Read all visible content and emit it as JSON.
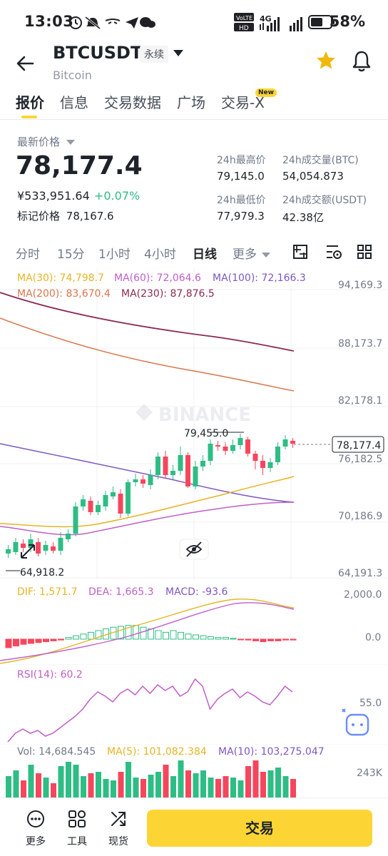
{
  "status_bar": {
    "time": "13:03",
    "network": "4G",
    "battery_pct": "58%"
  },
  "header": {
    "symbol": "BTCUSDT",
    "tag": "永续",
    "subtitle": "Bitcoin"
  },
  "tabs": [
    {
      "label": "报价",
      "active": true
    },
    {
      "label": "信息",
      "active": false
    },
    {
      "label": "交易数据",
      "active": false
    },
    {
      "label": "广场",
      "active": false
    },
    {
      "label": "交易-X",
      "active": false
    }
  ],
  "tab_badge": "New",
  "price_panel": {
    "latest_label": "最新价格",
    "last_price": "78,177.4",
    "fiat_price": "¥533,951.64",
    "change_pct": "+0.07%",
    "mark_label": "标记价格",
    "mark_price": "78,167.6",
    "stats": {
      "high_label": "24h最高价",
      "high": "79,145.0",
      "vol_btc_label": "24h成交量(BTC)",
      "vol_btc": "54,054.873",
      "low_label": "24h最低价",
      "low": "77,979.3",
      "vol_usdt_label": "24h成交额(USDT)",
      "vol_usdt": "42.38亿"
    }
  },
  "intervals": [
    {
      "label": "分时",
      "active": false
    },
    {
      "label": "15分",
      "active": false
    },
    {
      "label": "1小时",
      "active": false
    },
    {
      "label": "4小时",
      "active": false
    },
    {
      "label": "日线",
      "active": true
    },
    {
      "label": "更多",
      "active": false
    }
  ],
  "ma_legend": {
    "ma30": "MA(30): 74,798.7",
    "ma60": "MA(60): 72,064.6",
    "ma100": "MA(100): 72,166.3",
    "ma200": "MA(200): 83,670.4",
    "ma230": "MA(230): 87,876.5"
  },
  "watermark": "BINANCE",
  "chart_data": {
    "type": "candlestick",
    "y_ticks": [
      "94,169.3",
      "88,173.7",
      "82,178.1",
      "76,182.5",
      "70,186.9",
      "64,191.3"
    ],
    "ylim": [
      64191.3,
      94169.3
    ],
    "last_price_label": "78,177.4",
    "high_marker": "79,455.0",
    "low_marker": "64,918.2",
    "colors": {
      "up": "#2ebd85",
      "down": "#f6465d"
    }
  },
  "macd": {
    "dif": "DIF: 1,571.7",
    "dea": "DEA: 1,665.3",
    "macd": "MACD: -93.6",
    "ticks": [
      "2,000.0",
      "0.0"
    ]
  },
  "rsi": {
    "label": "RSI(14): 60.2",
    "tick": "55.0"
  },
  "volume": {
    "vol": "Vol: 14,684.545",
    "ma5": "MA(5): 101,082.384",
    "ma10": "MA(10): 103,275.047",
    "tick": "243K"
  },
  "bottom_bar": {
    "more": "更多",
    "tools": "工具",
    "spot": "现货",
    "trade": "交易"
  }
}
